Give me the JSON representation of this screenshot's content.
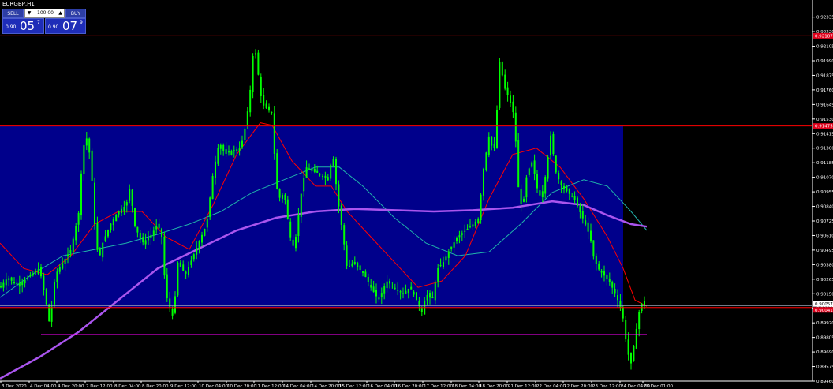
{
  "window": {
    "title": "EURGBP,H1",
    "sell_label": "SELL",
    "buy_label": "BUY",
    "lot_value": "100.00",
    "lot_decrease": "▼",
    "lot_increase": "▲",
    "sell_price_small": "0.90",
    "sell_price_big": "05",
    "sell_price_sup": "7",
    "buy_price_small": "0.90",
    "buy_price_big": "07",
    "buy_price_sup": "9"
  },
  "colors": {
    "background": "#000000",
    "candles": "#00ff00",
    "zone": "#00008b",
    "level_lines": "#ff0000",
    "support_line": "#ff00ff",
    "ma_slow": "#aa55ee",
    "ma_fast": "#ff0000",
    "ma_mid": "#20b2aa",
    "axis_text": "#ffffff"
  },
  "chart_data": {
    "type": "candlestick",
    "symbol": "EURGBP",
    "timeframe": "H1",
    "y_ticks": [
      "0.92335",
      "0.92220",
      "0.92105",
      "0.91990",
      "0.91875",
      "0.91760",
      "0.91645",
      "0.91530",
      "0.91415",
      "0.91300",
      "0.91185",
      "0.91070",
      "0.90955",
      "0.90840",
      "0.90725",
      "0.90610",
      "0.90495",
      "0.90380",
      "0.90265",
      "0.90150",
      "0.90035",
      "0.89920",
      "0.89805",
      "0.89690",
      "0.89575",
      "0.89460"
    ],
    "x_ticks": [
      "3 Dec 2020",
      "4 Dec 04:00",
      "4 Dec 20:00",
      "7 Dec 12:00",
      "8 Dec 04:00",
      "8 Dec 20:00",
      "9 Dec 12:00",
      "10 Dec 04:00",
      "10 Dec 20:00",
      "11 Dec 12:00",
      "14 Dec 04:00",
      "14 Dec 20:00",
      "15 Dec 12:00",
      "16 Dec 04:00",
      "16 Dec 20:00",
      "17 Dec 12:00",
      "18 Dec 04:00",
      "18 Dec 20:00",
      "21 Dec 12:00",
      "22 Dec 04:00",
      "22 Dec 20:00",
      "23 Dec 12:00",
      "24 Dec 04:00",
      "28 Dec 01:00"
    ],
    "ylim": [
      0.8946,
      0.9242
    ],
    "horizontal_levels": [
      {
        "name": "resistance-upper",
        "price": 0.92187,
        "color": "red"
      },
      {
        "name": "zone-top",
        "price": 0.91475,
        "color": "red"
      },
      {
        "name": "zone-bottom",
        "price": 0.90041,
        "color": "red"
      },
      {
        "name": "current-price",
        "price": 0.90057,
        "color": "white"
      },
      {
        "name": "support",
        "price": 0.89828,
        "color": "magenta"
      }
    ],
    "price_labels": [
      "0.92187",
      "0.91475",
      "0.90057",
      "0.90041"
    ],
    "zone": {
      "top": 0.91475,
      "bottom": 0.90041
    },
    "close_path": [
      [
        0,
        0.902
      ],
      [
        10,
        0.9028
      ],
      [
        20,
        0.9022
      ],
      [
        30,
        0.9025
      ],
      [
        40,
        0.903
      ],
      [
        50,
        0.9035
      ],
      [
        58,
        0.901
      ],
      [
        63,
        0.899
      ],
      [
        70,
        0.903
      ],
      [
        80,
        0.904
      ],
      [
        90,
        0.905
      ],
      [
        100,
        0.908
      ],
      [
        105,
        0.913
      ],
      [
        110,
        0.9138
      ],
      [
        115,
        0.912
      ],
      [
        120,
        0.907
      ],
      [
        125,
        0.904
      ],
      [
        130,
        0.9055
      ],
      [
        140,
        0.907
      ],
      [
        150,
        0.908
      ],
      [
        160,
        0.9085
      ],
      [
        165,
        0.91
      ],
      [
        170,
        0.907
      ],
      [
        180,
        0.9055
      ],
      [
        190,
        0.906
      ],
      [
        200,
        0.907
      ],
      [
        205,
        0.906
      ],
      [
        210,
        0.9015
      ],
      [
        215,
        0.9005
      ],
      [
        220,
        0.8995
      ],
      [
        225,
        0.904
      ],
      [
        235,
        0.903
      ],
      [
        245,
        0.9045
      ],
      [
        255,
        0.906
      ],
      [
        262,
        0.907
      ],
      [
        270,
        0.911
      ],
      [
        278,
        0.9135
      ],
      [
        285,
        0.9125
      ],
      [
        295,
        0.9128
      ],
      [
        305,
        0.913
      ],
      [
        312,
        0.915
      ],
      [
        318,
        0.918
      ],
      [
        322,
        0.9215
      ],
      [
        326,
        0.9195
      ],
      [
        332,
        0.9165
      ],
      [
        340,
        0.916
      ],
      [
        345,
        0.9158
      ],
      [
        350,
        0.91
      ],
      [
        355,
        0.909
      ],
      [
        360,
        0.9095
      ],
      [
        368,
        0.906
      ],
      [
        373,
        0.905
      ],
      [
        378,
        0.9075
      ],
      [
        383,
        0.91
      ],
      [
        388,
        0.9115
      ],
      [
        395,
        0.9112
      ],
      [
        405,
        0.911
      ],
      [
        415,
        0.9105
      ],
      [
        422,
        0.9125
      ],
      [
        428,
        0.909
      ],
      [
        435,
        0.906
      ],
      [
        440,
        0.9035
      ],
      [
        448,
        0.904
      ],
      [
        455,
        0.9035
      ],
      [
        462,
        0.903
      ],
      [
        470,
        0.902
      ],
      [
        480,
        0.901
      ],
      [
        490,
        0.9025
      ],
      [
        500,
        0.902
      ],
      [
        510,
        0.9015
      ],
      [
        520,
        0.902
      ],
      [
        528,
        0.901
      ],
      [
        535,
        0.9
      ],
      [
        540,
        0.9015
      ],
      [
        548,
        0.901
      ],
      [
        555,
        0.9035
      ],
      [
        562,
        0.904
      ],
      [
        570,
        0.905
      ],
      [
        580,
        0.906
      ],
      [
        590,
        0.9065
      ],
      [
        600,
        0.907
      ],
      [
        607,
        0.9075
      ],
      [
        612,
        0.911
      ],
      [
        620,
        0.914
      ],
      [
        626,
        0.9125
      ],
      [
        630,
        0.916
      ],
      [
        634,
        0.9205
      ],
      [
        638,
        0.918
      ],
      [
        645,
        0.917
      ],
      [
        652,
        0.9155
      ],
      [
        657,
        0.91
      ],
      [
        662,
        0.908
      ],
      [
        668,
        0.911
      ],
      [
        675,
        0.912
      ],
      [
        680,
        0.91
      ],
      [
        686,
        0.909
      ],
      [
        692,
        0.911
      ],
      [
        698,
        0.914
      ],
      [
        705,
        0.911
      ],
      [
        712,
        0.91
      ],
      [
        720,
        0.9095
      ],
      [
        728,
        0.909
      ],
      [
        735,
        0.908
      ],
      [
        742,
        0.907
      ],
      [
        748,
        0.906
      ],
      [
        752,
        0.9045
      ],
      [
        758,
        0.9035
      ],
      [
        765,
        0.903
      ],
      [
        772,
        0.9025
      ],
      [
        780,
        0.9015
      ],
      [
        786,
        0.9005
      ],
      [
        790,
        0.8995
      ],
      [
        795,
        0.897
      ],
      [
        800,
        0.896
      ],
      [
        805,
        0.898
      ],
      [
        810,
        0.9
      ],
      [
        815,
        0.901
      ],
      [
        820,
        0.9008
      ]
    ],
    "ma_slow_path": [
      [
        0,
        0.8948
      ],
      [
        50,
        0.8965
      ],
      [
        100,
        0.8985
      ],
      [
        150,
        0.901
      ],
      [
        200,
        0.9035
      ],
      [
        250,
        0.905
      ],
      [
        300,
        0.9065
      ],
      [
        350,
        0.9075
      ],
      [
        400,
        0.908
      ],
      [
        450,
        0.9082
      ],
      [
        500,
        0.9081
      ],
      [
        550,
        0.908
      ],
      [
        600,
        0.9081
      ],
      [
        650,
        0.9083
      ],
      [
        700,
        0.9088
      ],
      [
        740,
        0.9085
      ],
      [
        770,
        0.9077
      ],
      [
        800,
        0.907
      ],
      [
        820,
        0.9068
      ]
    ],
    "ma_mid_path": [
      [
        0,
        0.9012
      ],
      [
        40,
        0.903
      ],
      [
        80,
        0.9045
      ],
      [
        120,
        0.905
      ],
      [
        160,
        0.9055
      ],
      [
        200,
        0.9062
      ],
      [
        240,
        0.907
      ],
      [
        280,
        0.908
      ],
      [
        320,
        0.9095
      ],
      [
        360,
        0.9105
      ],
      [
        400,
        0.9115
      ],
      [
        430,
        0.9115
      ],
      [
        460,
        0.91
      ],
      [
        500,
        0.9075
      ],
      [
        540,
        0.9055
      ],
      [
        580,
        0.9045
      ],
      [
        620,
        0.9048
      ],
      [
        660,
        0.907
      ],
      [
        700,
        0.9095
      ],
      [
        740,
        0.9105
      ],
      [
        770,
        0.91
      ],
      [
        800,
        0.908
      ],
      [
        820,
        0.9065
      ]
    ],
    "ma_fast_path": [
      [
        0,
        0.9055
      ],
      [
        30,
        0.9035
      ],
      [
        60,
        0.903
      ],
      [
        90,
        0.9045
      ],
      [
        120,
        0.907
      ],
      [
        150,
        0.908
      ],
      [
        180,
        0.908
      ],
      [
        210,
        0.906
      ],
      [
        240,
        0.905
      ],
      [
        270,
        0.9085
      ],
      [
        300,
        0.9125
      ],
      [
        330,
        0.915
      ],
      [
        345,
        0.9148
      ],
      [
        370,
        0.912
      ],
      [
        400,
        0.91
      ],
      [
        420,
        0.91
      ],
      [
        440,
        0.908
      ],
      [
        470,
        0.906
      ],
      [
        500,
        0.904
      ],
      [
        530,
        0.902
      ],
      [
        560,
        0.9025
      ],
      [
        590,
        0.9045
      ],
      [
        620,
        0.909
      ],
      [
        650,
        0.9125
      ],
      [
        680,
        0.913
      ],
      [
        710,
        0.9115
      ],
      [
        740,
        0.909
      ],
      [
        770,
        0.906
      ],
      [
        790,
        0.9035
      ],
      [
        805,
        0.901
      ],
      [
        820,
        0.9005
      ]
    ]
  }
}
